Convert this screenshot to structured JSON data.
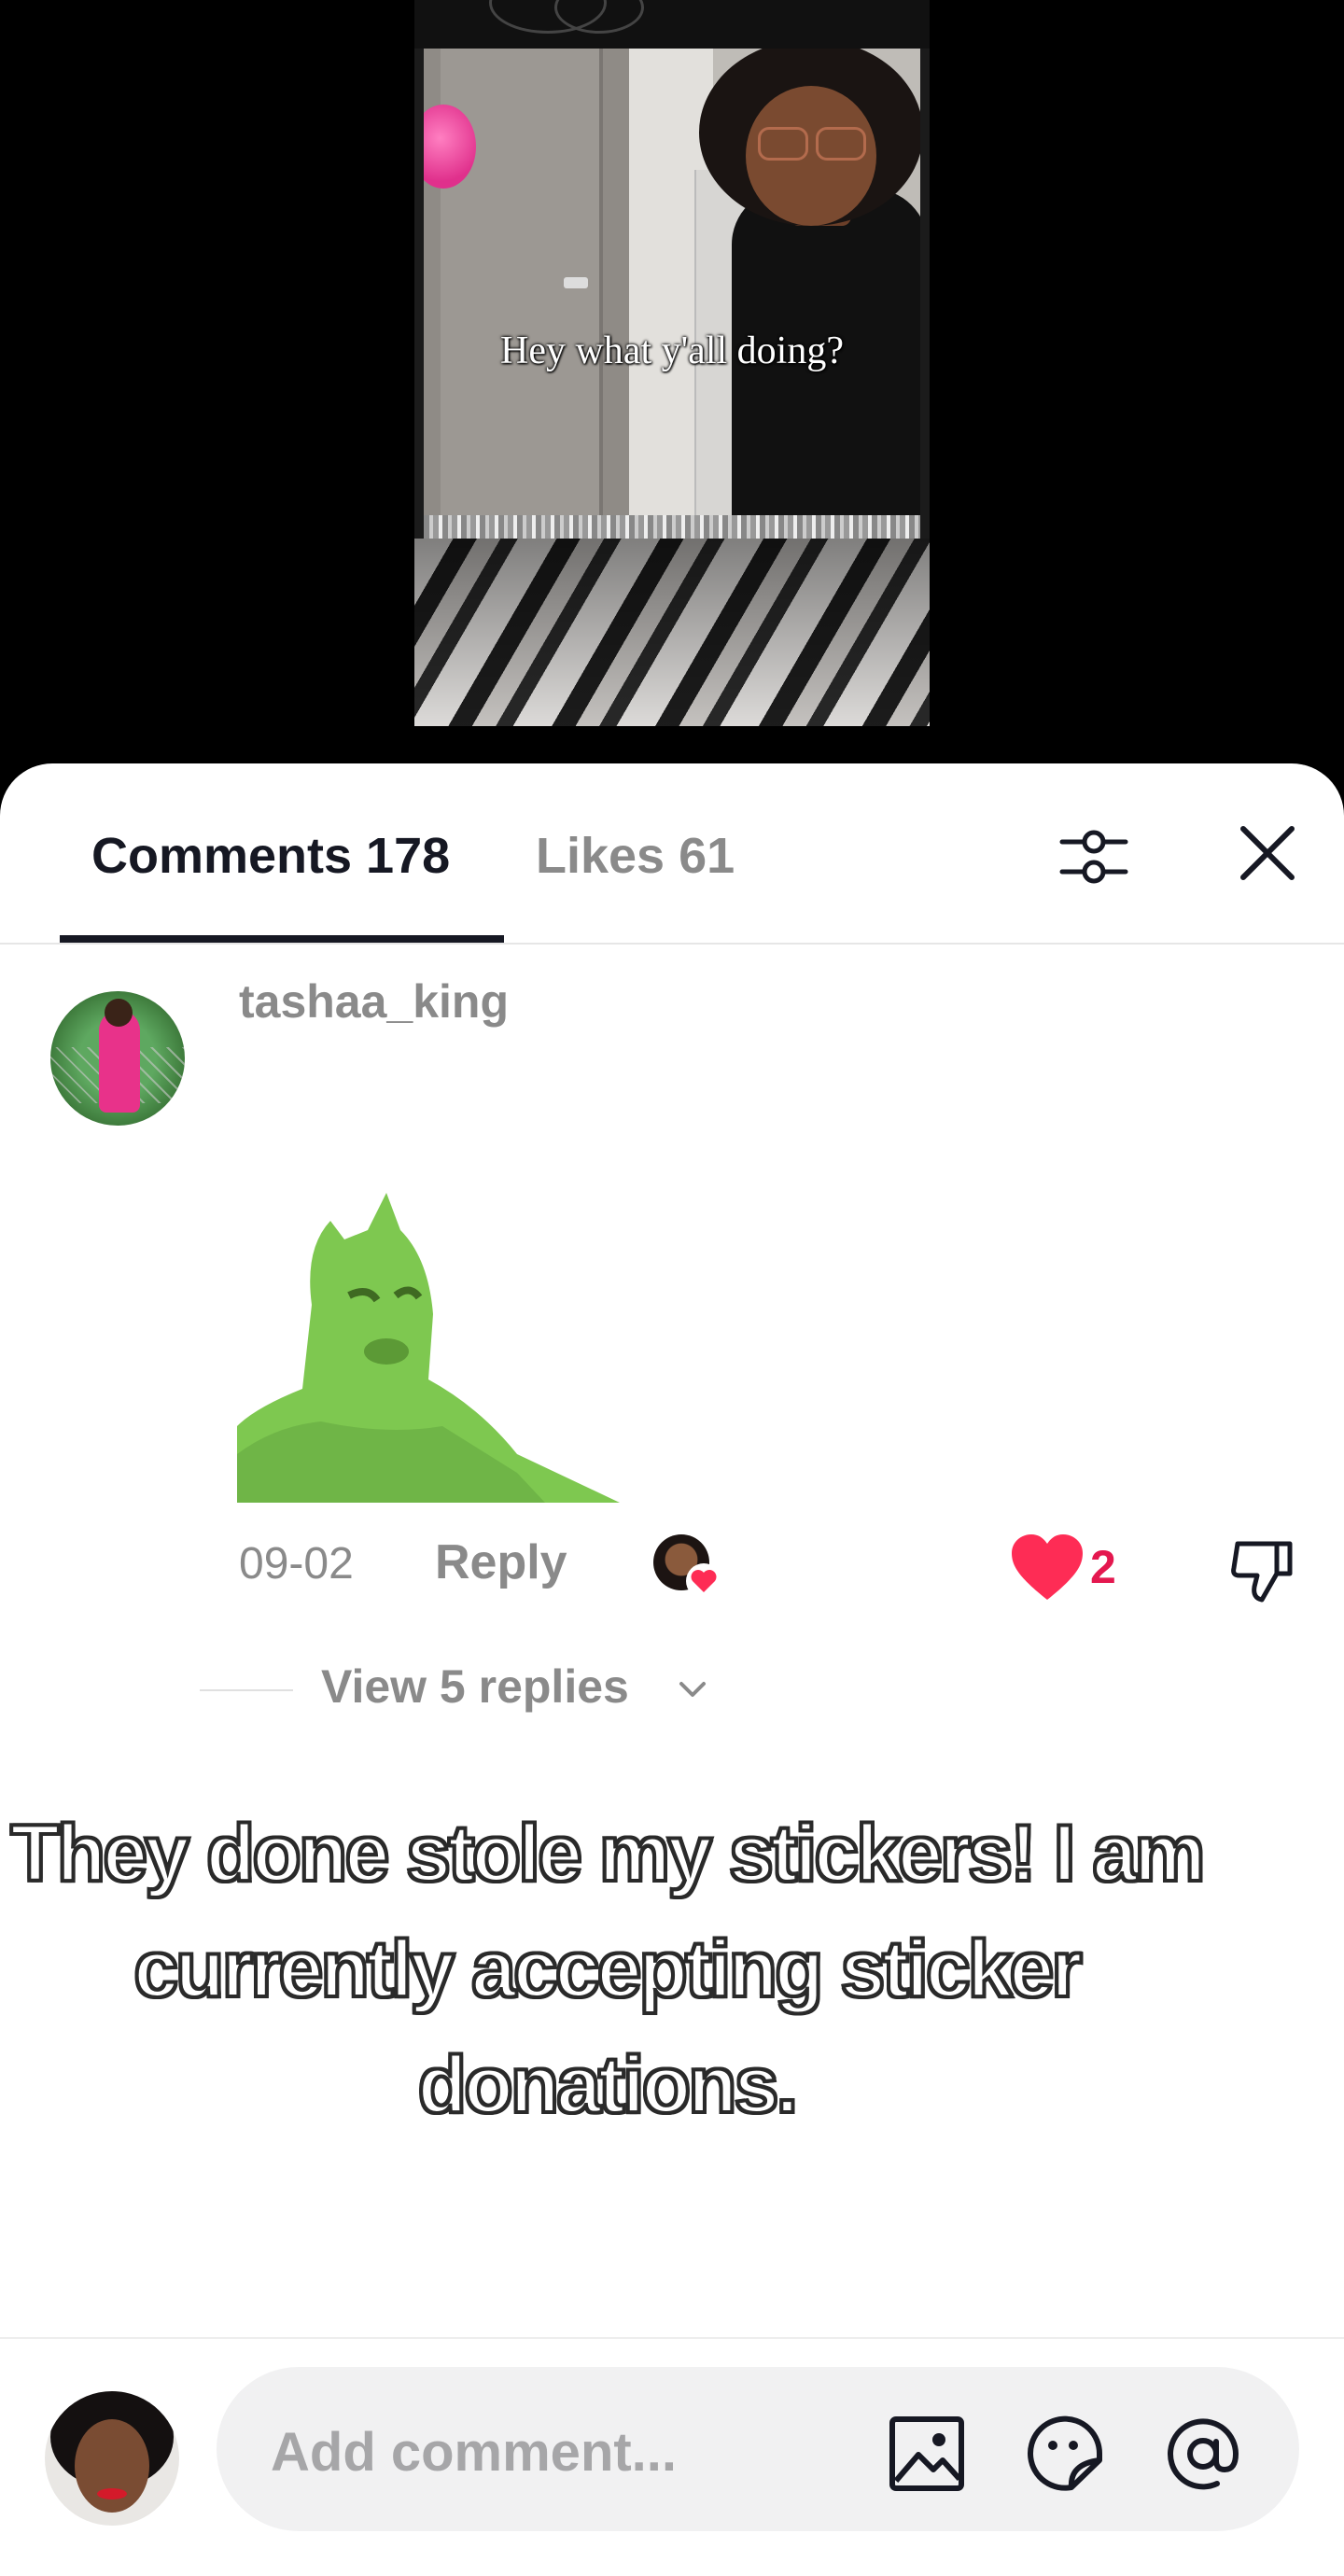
{
  "video": {
    "caption": "Hey what y'all doing?"
  },
  "tabs": {
    "comments_label": "Comments 178",
    "likes_label": "Likes 61"
  },
  "icons": {
    "filter": "sliders-icon",
    "close": "close-icon",
    "like": "heart-icon",
    "dislike": "thumbs-down-icon",
    "chevron": "chevron-down-icon",
    "image": "image-icon",
    "sticker": "sticker-icon",
    "mention": "at-icon"
  },
  "comment": {
    "username": "tashaa_king",
    "date": "09-02",
    "reply_label": "Reply",
    "like_count": "2",
    "view_replies": "View 5 replies"
  },
  "overlay": {
    "caption": "They done stole my stickers! I am currently accepting sticker donations."
  },
  "composer": {
    "placeholder": "Add comment..."
  },
  "colors": {
    "accent": "#e4184f",
    "text_primary": "#161823",
    "text_muted": "#8a8a8a",
    "input_bg": "#f1f1f2"
  }
}
